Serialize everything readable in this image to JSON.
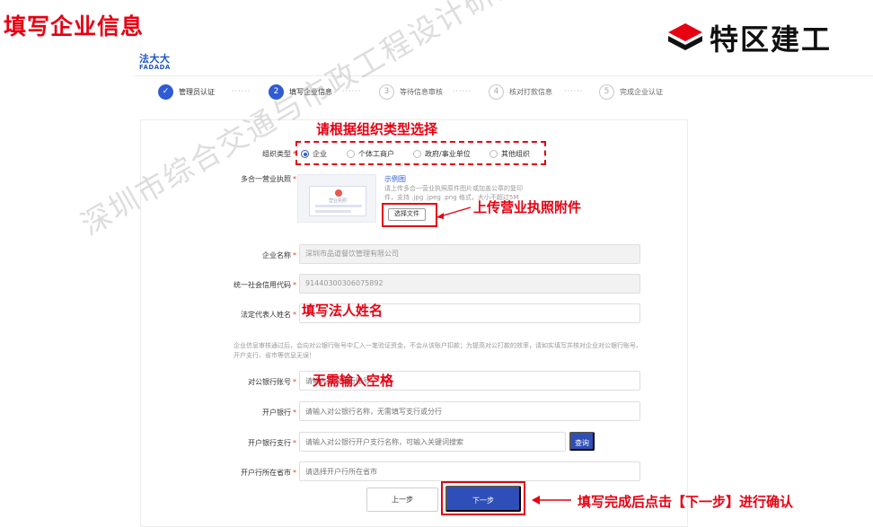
{
  "page_title": "填写企业信息",
  "brand": {
    "name": "特区建工"
  },
  "fadada": {
    "cn": "法大大",
    "en": "FADADA"
  },
  "steps": [
    {
      "num": "✓",
      "label": "管理员认证",
      "state": "done"
    },
    {
      "num": "2",
      "label": "填写企业信息",
      "state": "active"
    },
    {
      "num": "3",
      "label": "等待信息审核",
      "state": "pending"
    },
    {
      "num": "4",
      "label": "核对打款信息",
      "state": "pending"
    },
    {
      "num": "5",
      "label": "完成企业认证",
      "state": "pending"
    }
  ],
  "step_separator": "······",
  "annotations": {
    "org_type": "请根据组织类型选择",
    "upload": "上传营业执照附件",
    "legal_name": "填写法人姓名",
    "no_space": "无需输入空格",
    "next": "填写完成后点击【下一步】进行确认"
  },
  "form": {
    "org_type": {
      "label": "组织类型",
      "options": [
        "企业",
        "个体工商户",
        "政府/事业单位",
        "其他组织"
      ],
      "selected": "企业"
    },
    "license": {
      "label": "多合一营业执照",
      "sample_link": "示例图",
      "hint": "请上传多合一营业执照原件图片或加盖公章的复印件，支持 .jpg .jpeg .png 格式，大小不超过5M",
      "choose_file": "选择文件",
      "card_text": "营业执照"
    },
    "company_name": {
      "label": "企业名称",
      "value": "深圳市品道餐饮管理有限公司"
    },
    "credit_code": {
      "label": "统一社会信用代码",
      "value": "91440300306075892"
    },
    "legal_rep": {
      "label": "法定代表人姓名",
      "placeholder": ""
    },
    "notice": "企业信息审核通过后，会向对公银行账号中汇入一笔验证资金，不会从该账户扣款；为提高对公打款的效率，请如实填写并核对企业对公银行账号、开户支行、省市等信息无误！",
    "bank_account": {
      "label": "对公银行账号",
      "placeholder": "请输入对公银行账号"
    },
    "bank_name": {
      "label": "开户银行",
      "placeholder": "请输入对公银行名称，无需填写支行或分行"
    },
    "bank_branch": {
      "label": "开户银行支行",
      "placeholder": "请输入对公银行开户支行名称，可输入关键词搜索",
      "query_label": "查询"
    },
    "bank_province": {
      "label": "开户行所在省市",
      "placeholder": "请选择开户行所在省市"
    }
  },
  "buttons": {
    "prev": "上一步",
    "next": "下一步"
  },
  "watermark": "深圳市综合交通与市政工程设计研究总院有限公司",
  "colors": {
    "accent": "#2f4fb8",
    "annotation": "#e60012"
  }
}
